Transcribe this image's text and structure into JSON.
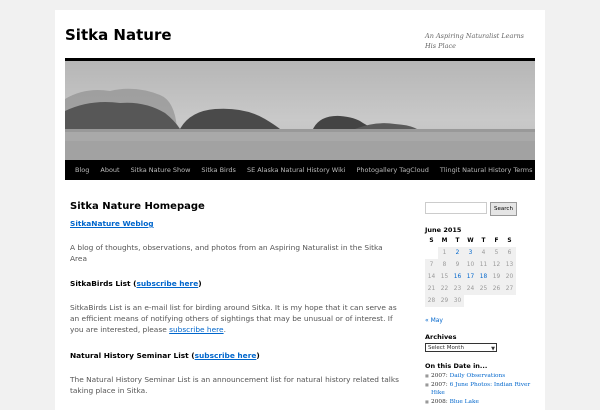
{
  "site": {
    "title": "Sitka Nature",
    "description": "An Aspiring Naturalist Learns His Place"
  },
  "nav": [
    "Blog",
    "About",
    "Sitka Nature Show",
    "Sitka Birds",
    "SE Alaska Natural History Wiki",
    "Photogallery TagCloud",
    "Tlingit Natural History Terms"
  ],
  "content": {
    "page_title": "Sitka Nature Homepage",
    "weblog_link": "SitkaNature Weblog",
    "weblog_desc": "A blog of thoughts, observations, and photos from an Aspiring Naturalist in the Sitka Area",
    "birds_heading": "SitkaBirds List",
    "birds_subscribe": "subscribe here",
    "birds_desc": "SitkaBirds List is an e-mail list for birding around Sitka. It is my hope that it can serve as an efficient means of notifying others of sightings that may be unusual or of interest. If you are interested, please",
    "birds_desc_link": "subscribe here",
    "seminar_heading": "Natural History Seminar List",
    "seminar_subscribe": "subscribe here",
    "seminar_desc": "The Natural History Seminar List is an announcement list for natural history related talks taking place in Sitka."
  },
  "sidebar": {
    "search_button": "Search",
    "calendar": {
      "caption": "June 2015",
      "days": [
        "S",
        "M",
        "T",
        "W",
        "T",
        "F",
        "S"
      ],
      "weeks": [
        [
          "",
          "1",
          "2",
          "3",
          "4",
          "5",
          "6"
        ],
        [
          "7",
          "8",
          "9",
          "10",
          "11",
          "12",
          "13"
        ],
        [
          "14",
          "15",
          "16",
          "17",
          "18",
          "19",
          "20"
        ],
        [
          "21",
          "22",
          "23",
          "24",
          "25",
          "26",
          "27"
        ],
        [
          "28",
          "29",
          "30",
          "",
          "",
          "",
          ""
        ]
      ],
      "linked_days": [
        "2",
        "3",
        "16",
        "17",
        "18"
      ],
      "prev": "« May"
    },
    "archives_title": "Archives",
    "archive_select": "Select Month",
    "on_this_date_title": "On this Date in...",
    "on_this_date": [
      {
        "year": "2007:",
        "link": "Daily Observations"
      },
      {
        "year": "2007:",
        "link": "6 June Photos: Indian River Hike"
      },
      {
        "year": "2008:",
        "link": "Blue Lake"
      }
    ]
  },
  "colors": {
    "link": "#0066cc",
    "nav_bg": "#000000",
    "page_bg": "#f1f1f1"
  }
}
